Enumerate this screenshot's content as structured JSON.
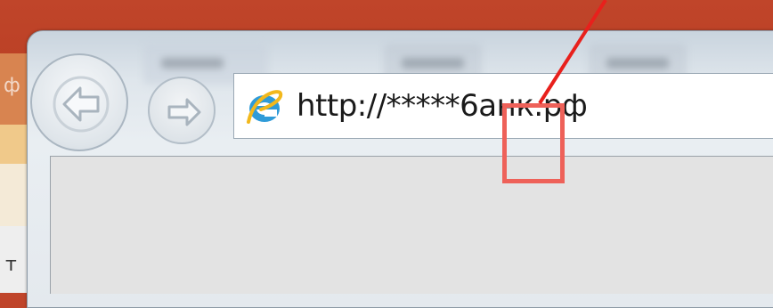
{
  "background_app": {
    "left_letter_top": "ф",
    "left_letter_bottom": "т"
  },
  "browser": {
    "address_bar": {
      "url": "http://*****6анк.рф"
    },
    "icons": {
      "back": "back-arrow-icon",
      "forward": "forward-arrow-icon",
      "browser_logo": "internet-explorer-icon"
    }
  },
  "annotation": {
    "highlight_color": "#ee6159",
    "arrow_color": "#e8201c"
  }
}
